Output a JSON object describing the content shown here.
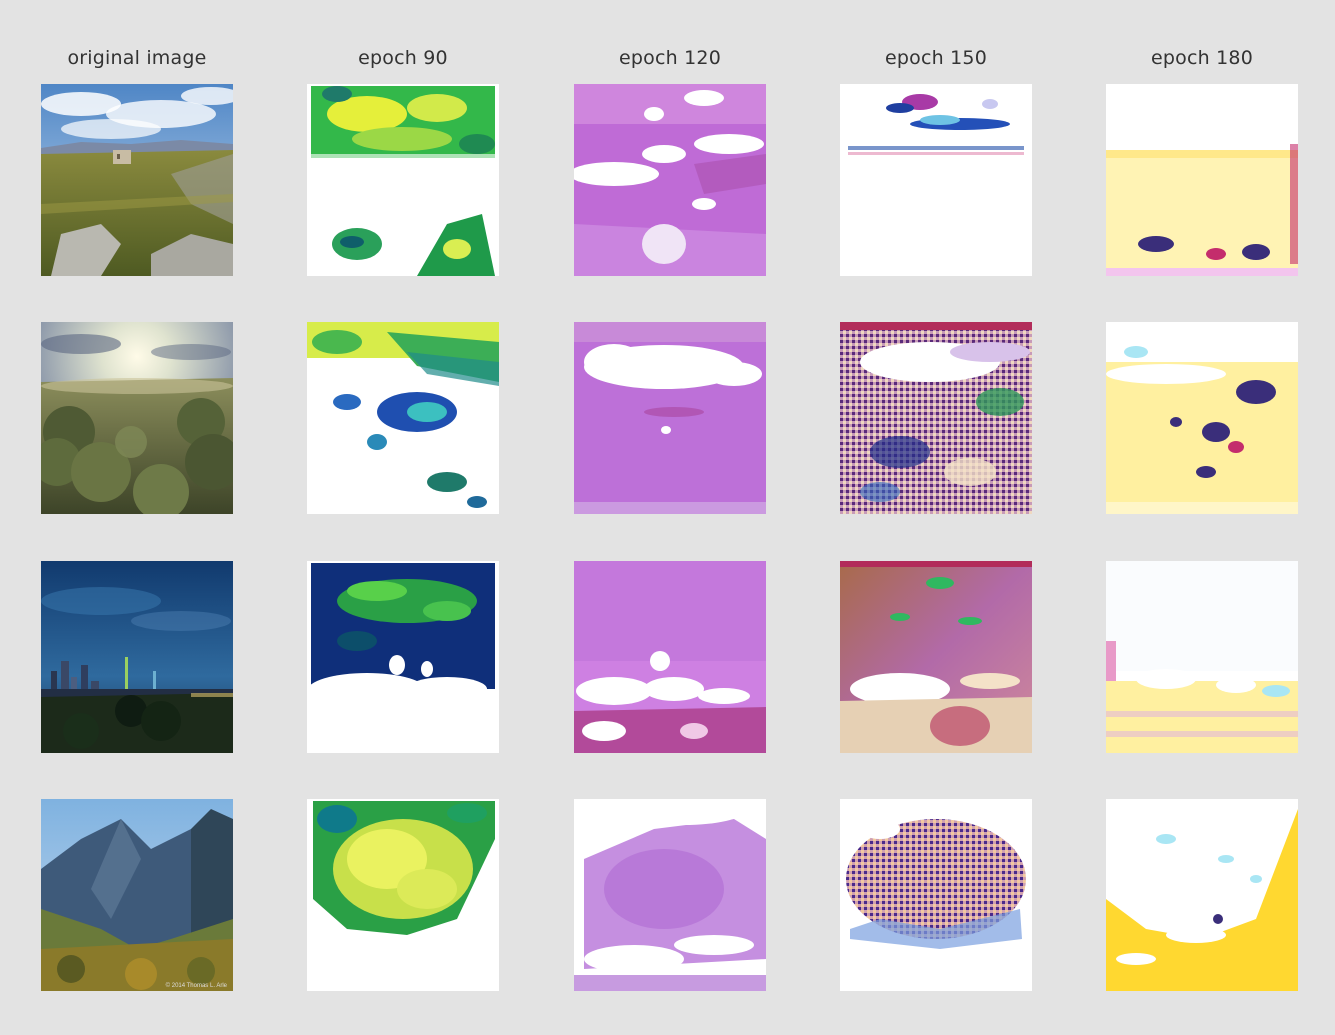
{
  "figure": {
    "columns": [
      {
        "title": "original image"
      },
      {
        "title": "epoch 90"
      },
      {
        "title": "epoch 120"
      },
      {
        "title": "epoch 150"
      },
      {
        "title": "epoch 180"
      }
    ],
    "rows": [
      {
        "tiles": [
          {
            "kind": "photo-grassland-ruin"
          },
          {
            "kind": "epoch90-green-white"
          },
          {
            "kind": "epoch120-purple-white"
          },
          {
            "kind": "epoch150-white-sparse"
          },
          {
            "kind": "epoch180-yellow-white"
          }
        ]
      },
      {
        "tiles": [
          {
            "kind": "photo-sunset-shrubs"
          },
          {
            "kind": "epoch90-green-white"
          },
          {
            "kind": "epoch120-purple-white"
          },
          {
            "kind": "epoch150-noisy-purple"
          },
          {
            "kind": "epoch180-yellow-white"
          }
        ]
      },
      {
        "tiles": [
          {
            "kind": "photo-night-city"
          },
          {
            "kind": "epoch90-green-dark"
          },
          {
            "kind": "epoch120-purple-white"
          },
          {
            "kind": "epoch150-brown-purple"
          },
          {
            "kind": "epoch180-white-yellow"
          }
        ]
      },
      {
        "tiles": [
          {
            "kind": "photo-mountain-valley"
          },
          {
            "kind": "epoch90-green-white"
          },
          {
            "kind": "epoch120-purple-white"
          },
          {
            "kind": "epoch150-noisy-blob"
          },
          {
            "kind": "epoch180-yellow-white"
          }
        ]
      }
    ],
    "watermark_text": "© 2014 Thomas L. Arle"
  }
}
